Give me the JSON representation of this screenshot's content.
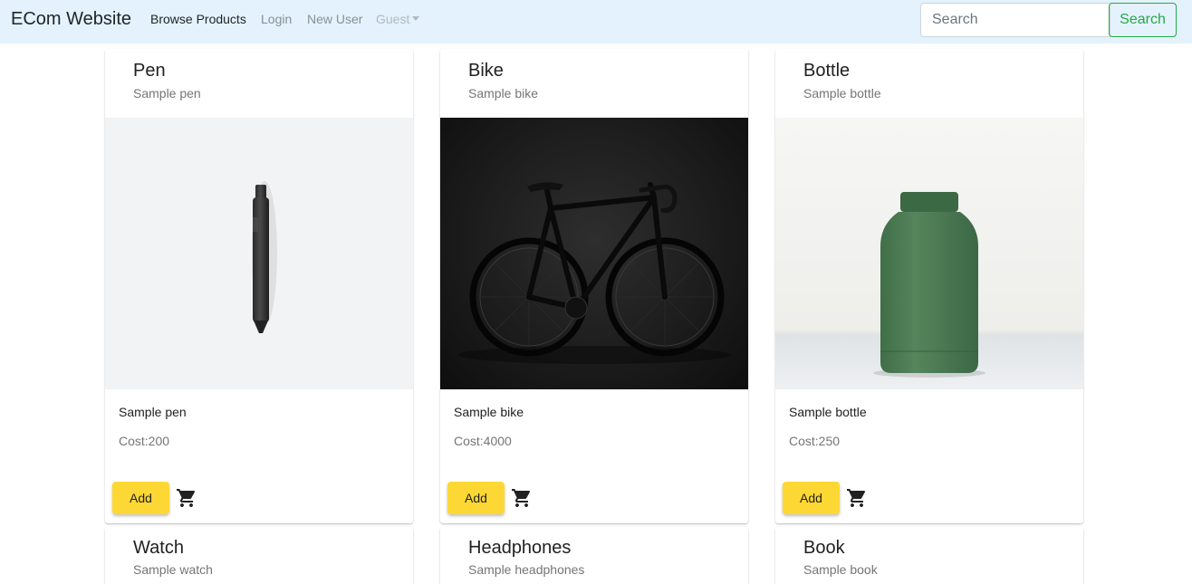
{
  "navbar": {
    "brand": "ECom Website",
    "links": [
      "Browse Products",
      "Login",
      "New User",
      "Guest"
    ],
    "search_placeholder": "Search",
    "search_button": "Search"
  },
  "products": [
    {
      "title": "Pen",
      "subtitle": "Sample pen",
      "description": "Sample pen",
      "cost": "Cost:200",
      "add_label": "Add",
      "image_icon": "pen-image"
    },
    {
      "title": "Bike",
      "subtitle": "Sample bike",
      "description": "Sample bike",
      "cost": "Cost:4000",
      "add_label": "Add",
      "image_icon": "bike-image"
    },
    {
      "title": "Bottle",
      "subtitle": "Sample bottle",
      "description": "Sample bottle",
      "cost": "Cost:250",
      "add_label": "Add",
      "image_icon": "bottle-image"
    },
    {
      "title": "Watch",
      "subtitle": "Sample watch"
    },
    {
      "title": "Headphones",
      "subtitle": "Sample headphones"
    },
    {
      "title": "Book",
      "subtitle": "Sample book"
    }
  ],
  "colors": {
    "navbar_bg": "#e3f2fd",
    "search_accent": "#28a745",
    "add_button": "#fdd835"
  }
}
